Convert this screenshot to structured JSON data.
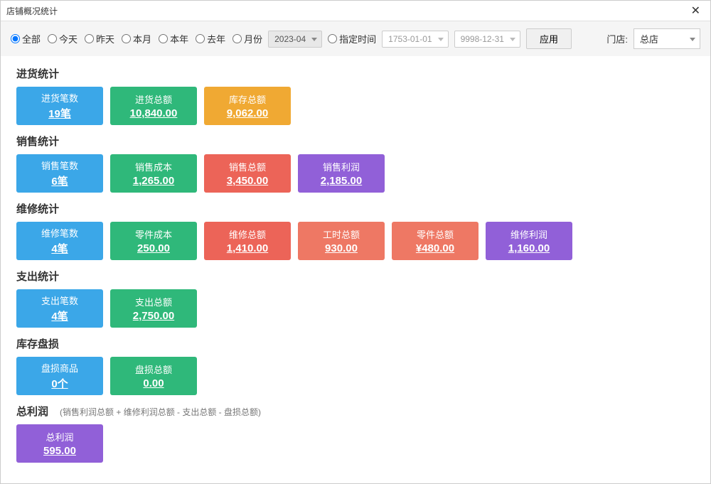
{
  "window": {
    "title": "店铺概况统计"
  },
  "toolbar": {
    "radios": {
      "all": "全部",
      "today": "今天",
      "yesterday": "昨天",
      "this_month": "本月",
      "this_year": "本年",
      "last_year": "去年",
      "month_range": "月份",
      "custom": "指定时间"
    },
    "month_value": "2023-04",
    "date_from": "1753-01-01",
    "date_to": "9998-12-31",
    "apply": "应用",
    "store_label": "门店:",
    "store_value": "总店"
  },
  "sections": {
    "purchase": {
      "title": "进货统计",
      "cards": {
        "count": {
          "label": "进货笔数",
          "value": "19笔"
        },
        "total": {
          "label": "进货总额",
          "value": "10,840.00"
        },
        "stock": {
          "label": "库存总额",
          "value": "9,062.00"
        }
      }
    },
    "sales": {
      "title": "销售统计",
      "cards": {
        "count": {
          "label": "销售笔数",
          "value": "6笔"
        },
        "cost": {
          "label": "销售成本",
          "value": "1,265.00"
        },
        "total": {
          "label": "销售总额",
          "value": "3,450.00"
        },
        "profit": {
          "label": "销售利润",
          "value": "2,185.00"
        }
      }
    },
    "repair": {
      "title": "维修统计",
      "cards": {
        "count": {
          "label": "维修笔数",
          "value": "4笔"
        },
        "parts_cost": {
          "label": "零件成本",
          "value": "250.00"
        },
        "total": {
          "label": "维修总额",
          "value": "1,410.00"
        },
        "labor": {
          "label": "工时总额",
          "value": "930.00"
        },
        "parts": {
          "label": "零件总额",
          "value": "¥480.00"
        },
        "profit": {
          "label": "维修利润",
          "value": "1,160.00"
        }
      }
    },
    "expense": {
      "title": "支出统计",
      "cards": {
        "count": {
          "label": "支出笔数",
          "value": "4笔"
        },
        "total": {
          "label": "支出总额",
          "value": "2,750.00"
        }
      }
    },
    "loss": {
      "title": "库存盘损",
      "cards": {
        "count": {
          "label": "盘损商品",
          "value": "0个"
        },
        "total": {
          "label": "盘损总额",
          "value": "0.00"
        }
      }
    },
    "profit": {
      "title": "总利润",
      "note": "(销售利润总额 + 维修利润总额 - 支出总额 - 盘损总额)",
      "cards": {
        "total": {
          "label": "总利润",
          "value": "595.00"
        }
      }
    }
  }
}
